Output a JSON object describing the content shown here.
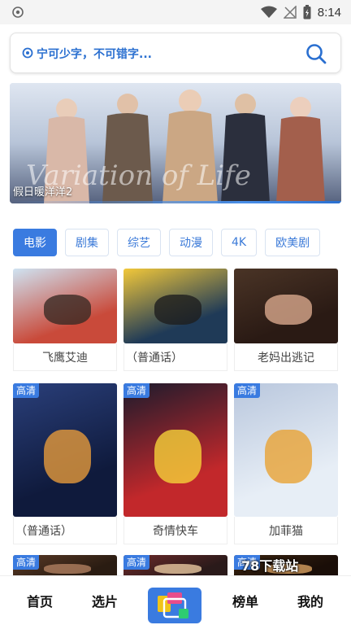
{
  "status_bar": {
    "time": "8:14",
    "icons": [
      "shield-icon",
      "wifi-icon",
      "no-signal-icon",
      "battery-charging-icon"
    ]
  },
  "search": {
    "placeholder": "宁可少字，不可错字...",
    "icon": "search-icon",
    "accent": "#2a6fd0"
  },
  "banner": {
    "caption": "假日暖洋洋2"
  },
  "categories": [
    {
      "label": "电影",
      "active": true
    },
    {
      "label": "剧集",
      "active": false
    },
    {
      "label": "综艺",
      "active": false
    },
    {
      "label": "动漫",
      "active": false
    },
    {
      "label": "4K",
      "active": false
    },
    {
      "label": "欧美剧",
      "active": false
    }
  ],
  "movies": [
    {
      "title": "飞鹰艾迪",
      "badge": ""
    },
    {
      "title": "（普通话）",
      "badge": ""
    },
    {
      "title": "老妈出逃记",
      "badge": ""
    },
    {
      "title": "（普通话）",
      "badge": "高清"
    },
    {
      "title": "奇情快车",
      "badge": "高清"
    },
    {
      "title": "加菲猫",
      "badge": "高清"
    },
    {
      "title": "",
      "badge": "高清"
    },
    {
      "title": "",
      "badge": "高清"
    },
    {
      "title": "",
      "badge": "高清"
    }
  ],
  "bottom_nav": {
    "home": "首页",
    "pick": "选片",
    "ranking": "榜单",
    "mine": "我的"
  },
  "watermark": "78下载站",
  "colors": {
    "primary": "#3a7be0"
  }
}
